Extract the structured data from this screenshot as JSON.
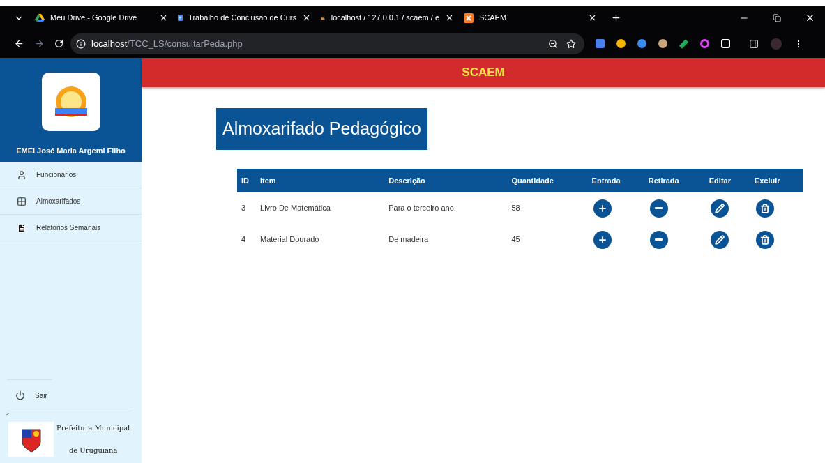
{
  "browser": {
    "tabs": [
      {
        "title": "Meu Drive - Google Drive",
        "kind": "drive"
      },
      {
        "title": "Trabalho de Conclusão de Curs",
        "kind": "docs"
      },
      {
        "title": "localhost / 127.0.0.1 / scaem / e",
        "kind": "pma"
      },
      {
        "title": "SCAEM",
        "kind": "xampp"
      }
    ],
    "address": {
      "host": "localhost",
      "path": "/TCC_LS/consultarPeda.php"
    }
  },
  "sidebar": {
    "school_name": "EMEI José Maria Argemi Filho",
    "items": [
      {
        "label": "Funcionários",
        "kind": "user"
      },
      {
        "label": "Almoxarifados",
        "kind": "grid"
      },
      {
        "label": "Relatórios Semanais",
        "kind": "doc"
      }
    ],
    "logout": "Sair",
    "arrow": ">",
    "footer": [
      "Prefeitura Municipal",
      "de Uruguiana"
    ]
  },
  "header": {
    "brand": "SCAEM"
  },
  "page_title": "Almoxarifado Pedagógico",
  "table": {
    "columns": [
      "ID",
      "Item",
      "Descrição",
      "Quantidade",
      "Entrada",
      "Retirada",
      "Editar",
      "Excluir"
    ],
    "rows": [
      {
        "id": "3",
        "item": "Livro De Matemática",
        "description": "Para o terceiro ano.",
        "quantity": "58"
      },
      {
        "id": "4",
        "item": "Material Dourado",
        "description": "De madeira",
        "quantity": "45"
      }
    ]
  }
}
